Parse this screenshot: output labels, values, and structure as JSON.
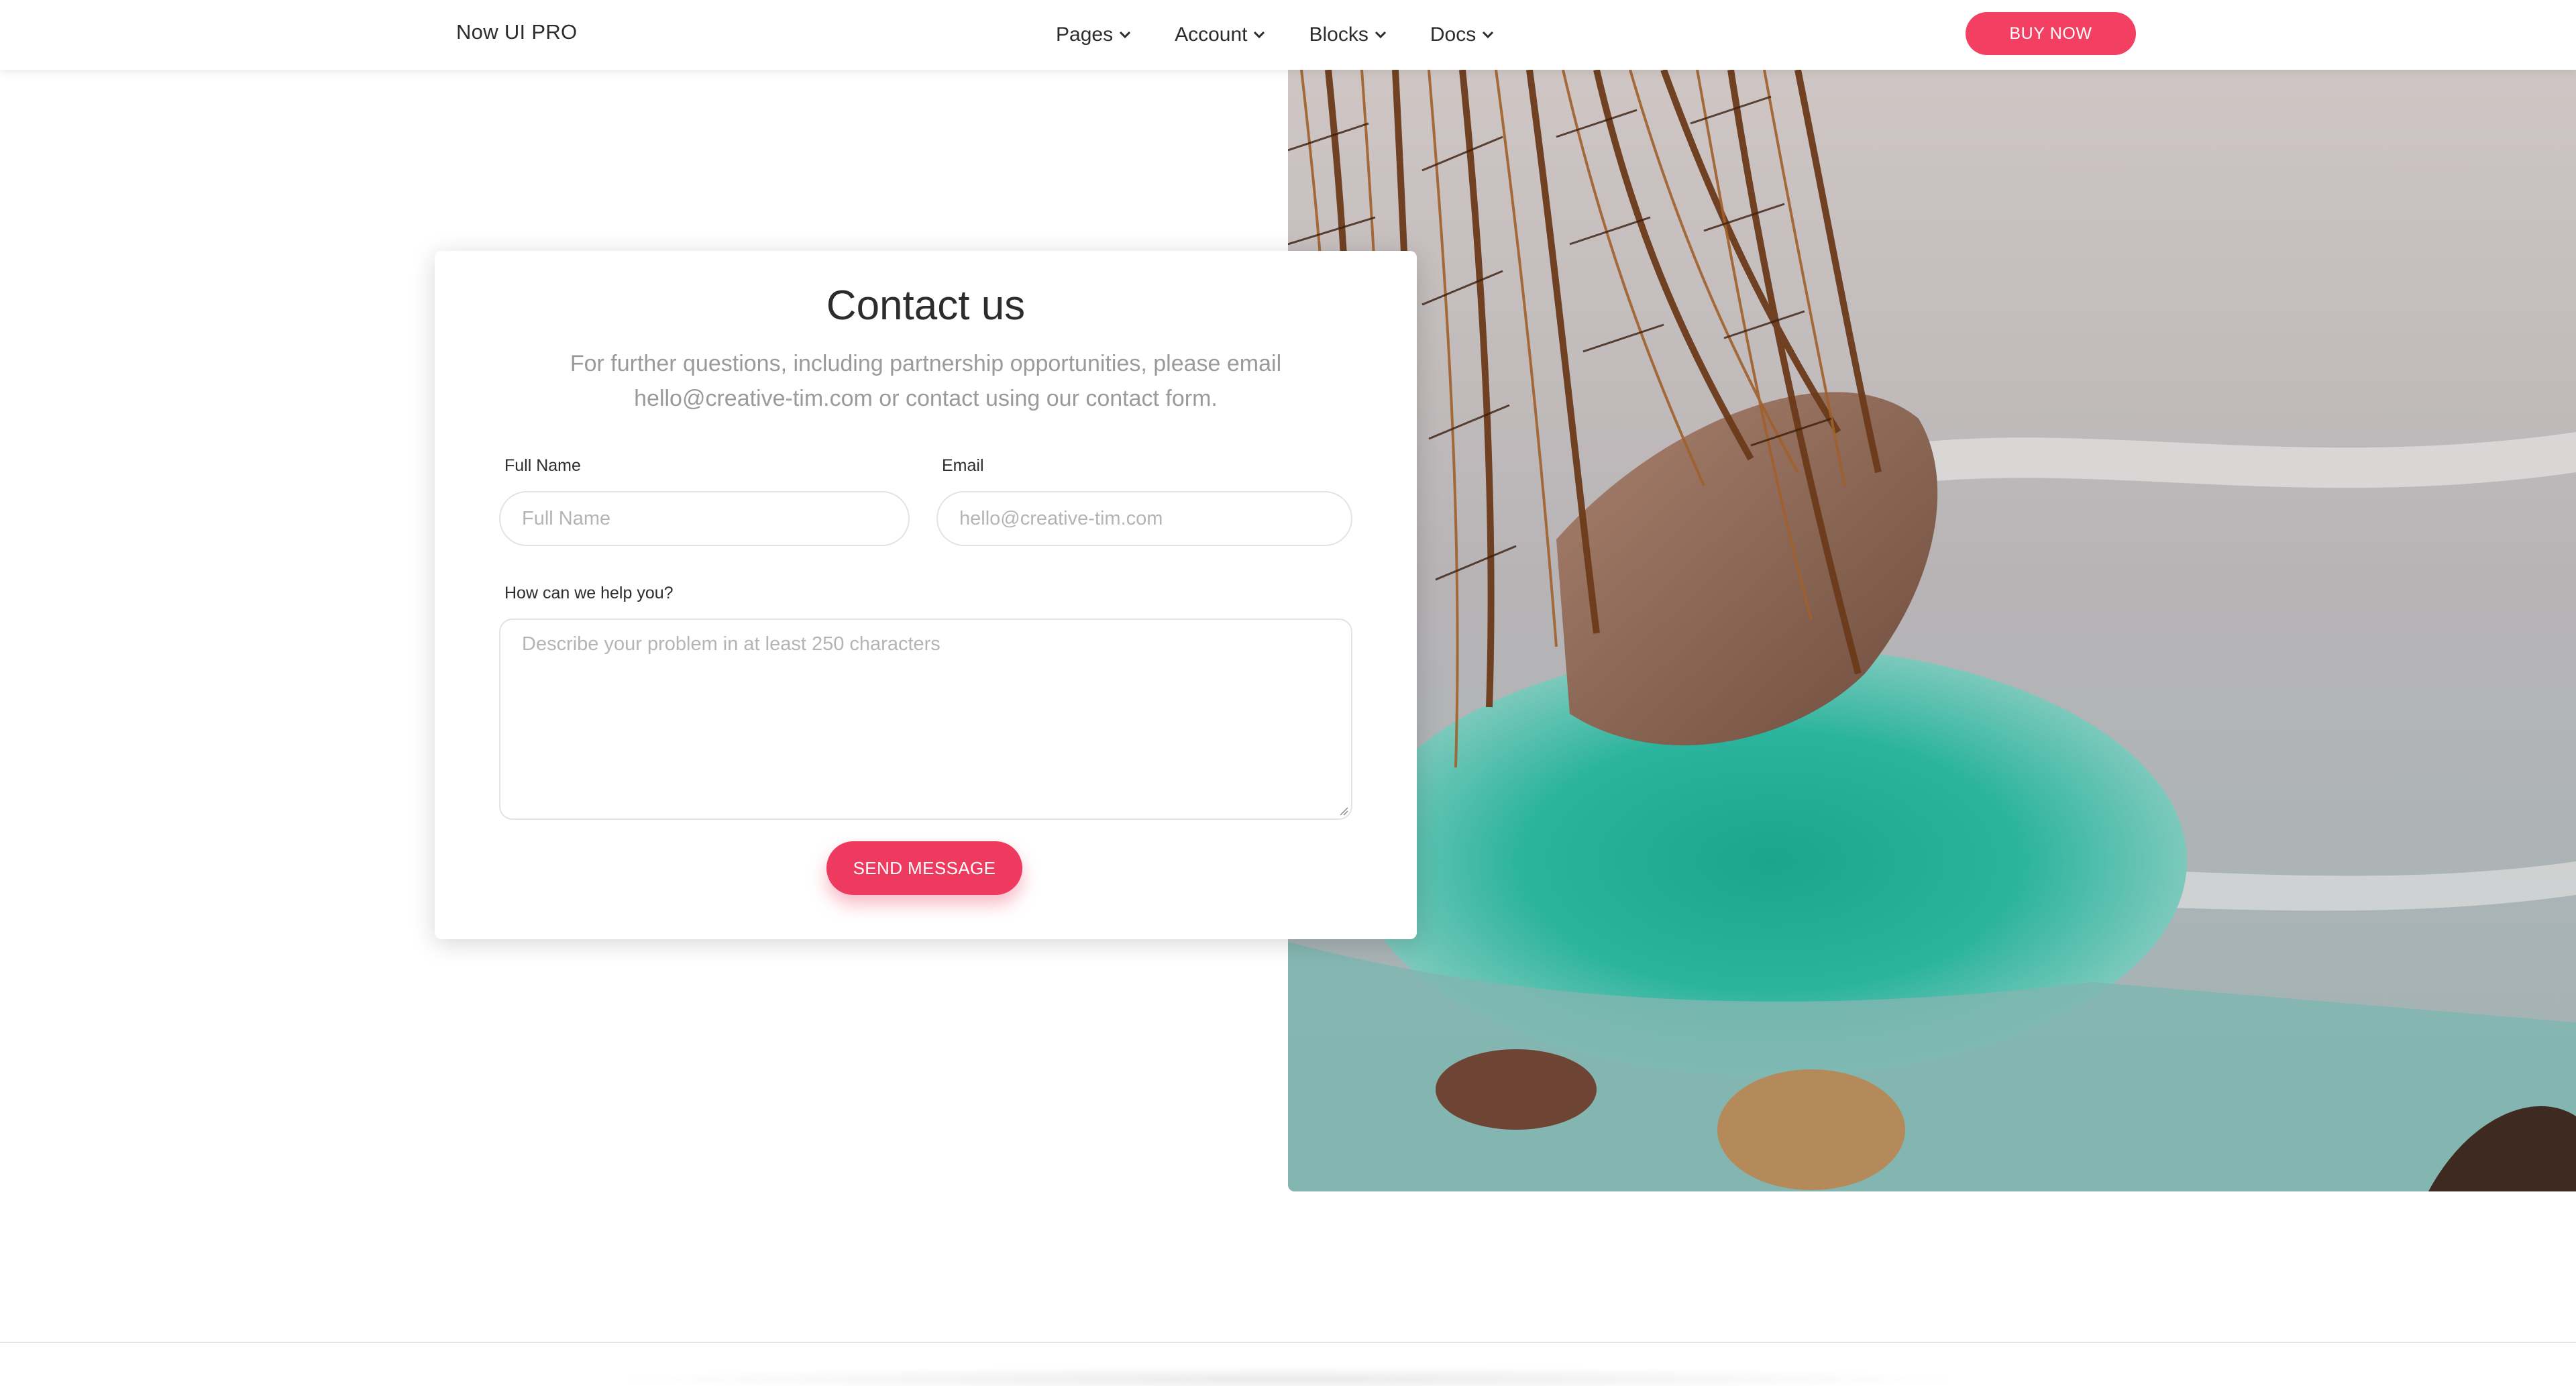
{
  "navbar": {
    "brand": "Now UI PRO",
    "items": [
      {
        "label": "Pages"
      },
      {
        "label": "Account"
      },
      {
        "label": "Blocks"
      },
      {
        "label": "Docs"
      }
    ],
    "buy_label": "BUY NOW"
  },
  "contact": {
    "title": "Contact us",
    "description": "For further questions, including partnership opportunities, please email hello@creative-tim.com or contact using our contact form.",
    "full_name_label": "Full Name",
    "full_name_placeholder": "Full Name",
    "email_label": "Email",
    "email_placeholder": "hello@creative-tim.com",
    "message_label": "How can we help you?",
    "message_placeholder": "Describe your problem in at least 250 characters",
    "send_label": "SEND MESSAGE"
  },
  "colors": {
    "accent": "#f33f62",
    "text": "#2c2c2c",
    "muted": "#9a9a9a"
  },
  "icons": {
    "nav_dropdown": "chevron-down-icon",
    "photo": "palm-coast-image"
  }
}
